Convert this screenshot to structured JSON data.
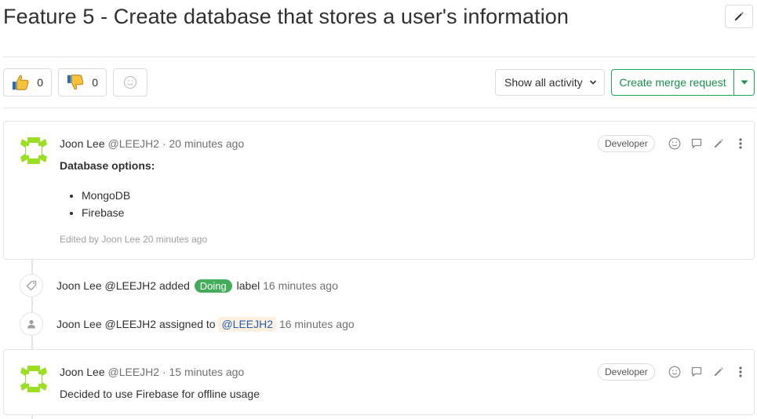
{
  "issue": {
    "title": "Feature 5 - Create database that stores a user's information"
  },
  "awards": {
    "thumbs_up_count": "0",
    "thumbs_down_count": "0"
  },
  "controls": {
    "activity_filter": "Show all activity",
    "merge_request_label": "Create merge request"
  },
  "notes": [
    {
      "author": "Joon Lee",
      "handle": "@LEEJH2",
      "time": "· 20 minutes ago",
      "role": "Developer",
      "body_heading": "Database options:",
      "list": [
        "MongoDB",
        "Firebase"
      ],
      "edited": "Edited by Joon Lee 20 minutes ago"
    },
    {
      "author": "Joon Lee",
      "handle": "@LEEJH2",
      "time": "· 15 minutes ago",
      "role": "Developer",
      "body": "Decided to use Firebase for offline usage"
    }
  ],
  "system_notes": [
    {
      "author": "Joon Lee",
      "handle": "@LEEJH2",
      "action": "added",
      "label": "Doing",
      "suffix": "label",
      "time": "16 minutes ago"
    },
    {
      "author": "Joon Lee",
      "handle": "@LEEJH2",
      "action": "assigned to",
      "assignee": "@LEEJH2",
      "time": "16 minutes ago"
    }
  ],
  "colors": {
    "accent_green": "#1aaa55",
    "label_doing": "#44ad5b",
    "avatar_lime": "#9adf22"
  }
}
